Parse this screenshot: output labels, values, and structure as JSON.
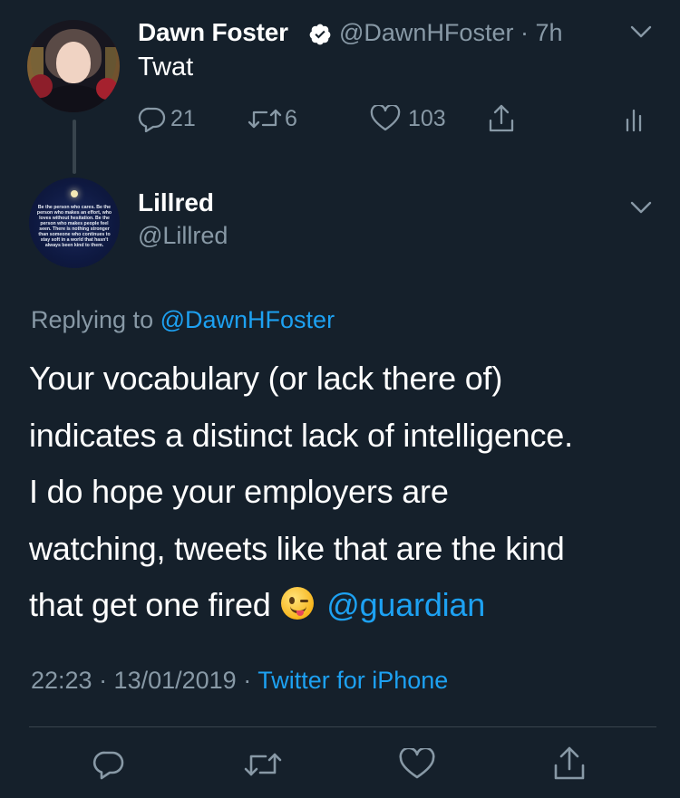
{
  "parent_tweet": {
    "display_name": "Dawn Foster",
    "handle": "@DawnHFoster",
    "time": "· 7h",
    "text": "Twat",
    "reply_count": "21",
    "retweet_count": "6",
    "like_count": "103"
  },
  "main_tweet": {
    "display_name": "Lillred",
    "handle": "@Lillred",
    "replying_prefix": "Replying to",
    "replying_to": "@DawnHFoster",
    "body_lines": [
      "Your vocabulary (or lack there of)",
      "indicates a distinct lack of intelligence.",
      "I do hope your employers are",
      "watching, tweets like that are the kind",
      "that get one fired"
    ],
    "body_mention": "@guardian",
    "emoji_icon": "winking-face-tongue-emoji",
    "timestamp": "22:23 · 13/01/2019 · ",
    "source": "Twitter for iPhone",
    "avatar_text": "Be the person who cares. Be the person who makes an effort, who loves without hesitation. Be the person who makes people feel seen. There is nothing stronger than someone who continues to stay soft in a world that hasn't always been kind to them."
  },
  "icons": {
    "verified": "verified-badge-icon",
    "chevron": "chevron-down-icon",
    "reply": "reply-icon",
    "retweet": "retweet-icon",
    "like": "heart-icon",
    "share": "share-icon",
    "analytics": "analytics-icon"
  },
  "colors": {
    "background": "#15202b",
    "text": "#ffffff",
    "secondary": "#8899a6",
    "accent": "#1da1f2",
    "divider": "#38444d"
  }
}
